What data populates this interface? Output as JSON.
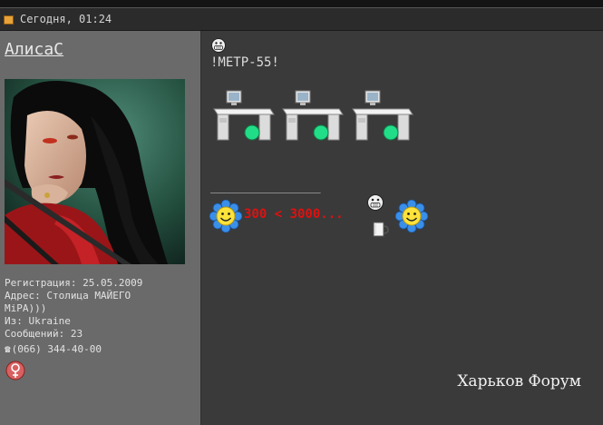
{
  "post_header": {
    "date_text": "Сегодня, 01:24"
  },
  "author": {
    "username": "АлисаС",
    "registration": "Регистрация: 25.05.2009",
    "address_line1": "Адрес: Столица МАЙЕГО",
    "address_line2": "МiРА)))",
    "from": "Из: Ukraine",
    "posts": "Сообщений: 23",
    "phone": "(066) 344-40-00"
  },
  "post": {
    "title": "!МЕТР-55!",
    "separator": "__________________",
    "progress_text": "300 < 3000...",
    "forum_name": "Харьков Форум"
  },
  "icons": {
    "post_marker": "post-icon",
    "phone": "phone-icon",
    "gender": "female-gender-icon",
    "grin": "grin-smiley-icon",
    "computer": "computer-desk-icon",
    "flower_smiley": "flower-smiley-icon",
    "mug": "mug-icon"
  },
  "colors": {
    "progress_text": "#e01010",
    "background_post": "#3a3a3a",
    "background_profile": "#6a6a6a"
  }
}
